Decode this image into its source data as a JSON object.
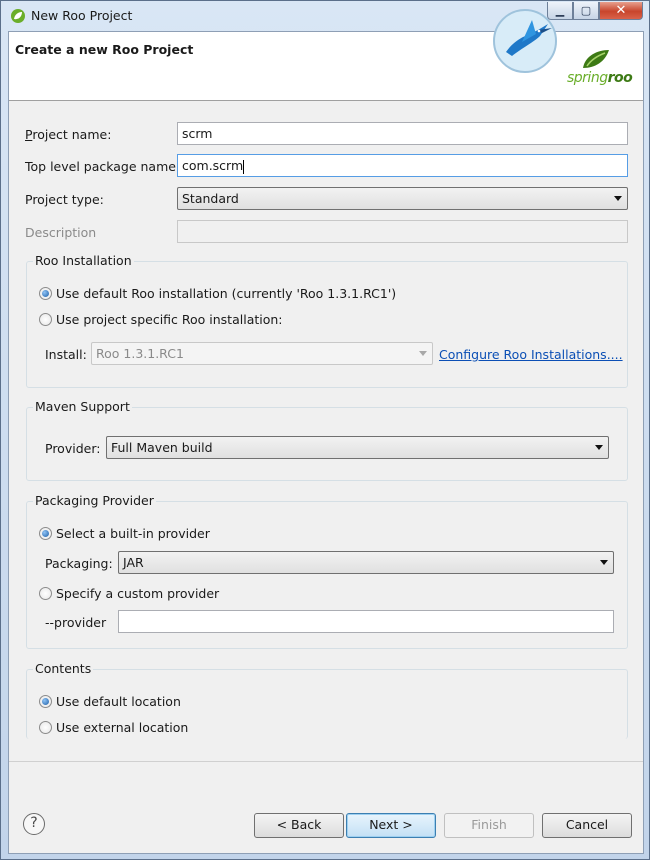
{
  "window": {
    "title": "New Roo Project",
    "minimize_glyph": "▁",
    "maximize_glyph": "▢",
    "close_glyph": "✕"
  },
  "header": {
    "title": "Create a new Roo Project",
    "logo_text_part1": "spring",
    "logo_text_part2": "roo"
  },
  "form": {
    "project_name_label": "Project name:",
    "project_name_value": "scrm",
    "package_label": "Top level package name:",
    "package_value": "com.scrm",
    "project_type_label": "Project type:",
    "project_type_value": "Standard",
    "description_label": "Description",
    "description_value": ""
  },
  "roo_installation": {
    "title": "Roo Installation",
    "option_default": "Use default Roo installation (currently 'Roo 1.3.1.RC1')",
    "option_specific": "Use project specific Roo installation:",
    "install_label": "Install:",
    "install_value": "Roo 1.3.1.RC1",
    "configure_link": "Configure Roo Installations...."
  },
  "maven_support": {
    "title": "Maven Support",
    "provider_label": "Provider:",
    "provider_value": "Full Maven build"
  },
  "packaging_provider": {
    "title": "Packaging Provider",
    "option_builtin": "Select a built-in provider",
    "packaging_label": "Packaging:",
    "packaging_value": "JAR",
    "option_custom": "Specify a custom provider",
    "provider_label": "--provider",
    "provider_value": ""
  },
  "contents": {
    "title": "Contents",
    "option_default": "Use default location",
    "option_external": "Use external location"
  },
  "buttons": {
    "help": "?",
    "back": "< Back",
    "next": "Next >",
    "finish": "Finish",
    "cancel": "Cancel"
  },
  "colors": {
    "link": "#0b4fb5",
    "logo_green": "#6aae2a",
    "focus_border": "#569de5"
  }
}
